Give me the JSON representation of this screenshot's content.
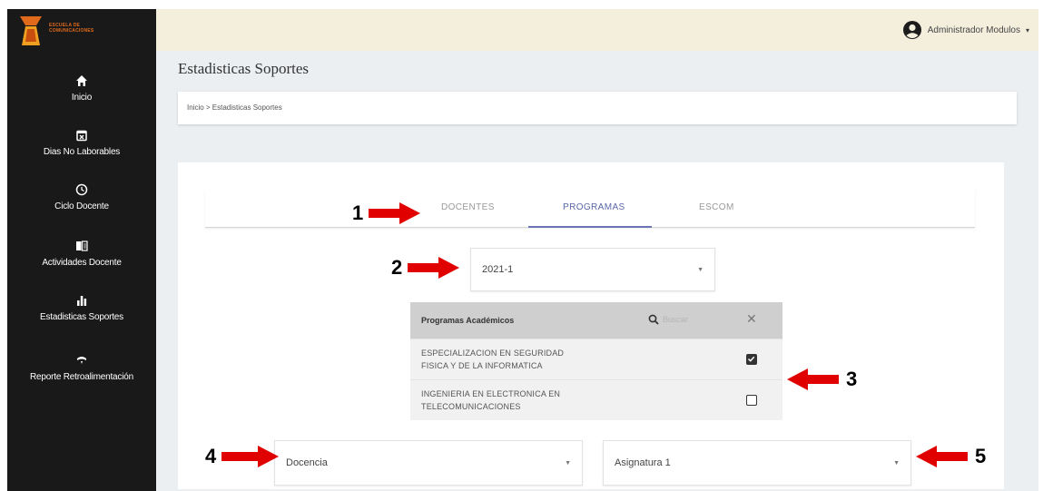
{
  "brand": {
    "logo_text_line1": "ESCUELA DE",
    "logo_text_line2": "COMUNICACIONES",
    "accent_color": "#e06a1c"
  },
  "sidebar": {
    "items": [
      {
        "label": "Inicio",
        "icon": "home-icon"
      },
      {
        "label": "Dias No Laborables",
        "icon": "calendar-x-icon"
      },
      {
        "label": "Ciclo Docente",
        "icon": "clock-icon"
      },
      {
        "label": "Actividades Docente",
        "icon": "book-icon"
      },
      {
        "label": "Estadisticas Soportes",
        "icon": "bar-chart-icon"
      },
      {
        "label": "Reporte Retroalimentación",
        "icon": "feedback-icon"
      }
    ]
  },
  "topbar": {
    "user_label": "Administrador Modulos",
    "user_caret": "▾"
  },
  "page": {
    "title": "Estadisticas Soportes",
    "breadcrumb": "Inicio > Estadisticas Soportes"
  },
  "tabs": [
    {
      "label": "DOCENTES",
      "active": false
    },
    {
      "label": "PROGRAMAS",
      "active": true
    },
    {
      "label": "ESCOM",
      "active": false
    }
  ],
  "period_select": {
    "value": "2021-1",
    "arrow": "▼"
  },
  "programs_table": {
    "title": "Programas Académicos",
    "search_placeholder": "Buscar",
    "close": "✕",
    "rows": [
      {
        "label": "ESPECIALIZACION EN SEGURIDAD\nFISICA Y DE LA INFORMATICA",
        "checked": true
      },
      {
        "label": "INGENIERIA EN ELECTRONICA EN\nTELECOMUNICACIONES",
        "checked": false
      }
    ]
  },
  "category_select": {
    "value": "Docencia",
    "arrow": "▼"
  },
  "subject_select": {
    "value": "Asignatura 1",
    "arrow": "▼"
  },
  "annotations": {
    "n1": "1",
    "n2": "2",
    "n3": "3",
    "n4": "4",
    "n5": "5",
    "color": "#e00000"
  }
}
